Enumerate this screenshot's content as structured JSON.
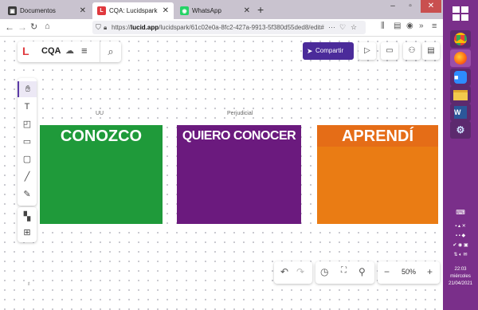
{
  "browser": {
    "tabs": [
      {
        "label": "Documentos",
        "favicon_color": "#3a3a3a"
      },
      {
        "label": "CQA: Lucidspark",
        "favicon_color": "#e0393e"
      },
      {
        "label": "WhatsApp",
        "favicon_color": "#25d366"
      }
    ],
    "url_prefix": "https://",
    "url_host": "lucid.app",
    "url_path": "/lucidspark/61c02e0a-8fc2-427a-9913-5f380d55ded8/edit#",
    "url_more": "···"
  },
  "app": {
    "logo": "L",
    "title": "CQA",
    "share_label": "Compartir",
    "zoom": "50%"
  },
  "board": {
    "labels": [
      "UU",
      "Perjudicial"
    ],
    "cards": [
      {
        "title": "CONOZCO",
        "color": "#1f9a3a",
        "title_bar": "#1f9a3a"
      },
      {
        "title": "QUIERO CONOCER",
        "color": "#6b1a7e",
        "title_bar": "#6b1a7e"
      },
      {
        "title": "APRENDÍ",
        "color": "#ea7c14",
        "title_bar": "#e56d17"
      }
    ]
  },
  "taskbar": {
    "time": "22:03",
    "day": "miércoles",
    "date": "21/04/2021"
  },
  "colors": {
    "accent": "#4b2b9a",
    "sidebar": "#7a2f8a"
  }
}
